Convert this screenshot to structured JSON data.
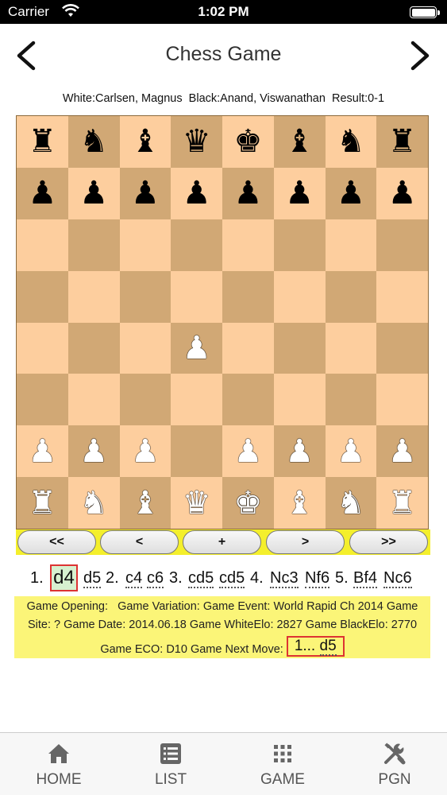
{
  "status_bar": {
    "carrier": "Carrier",
    "time": "1:02 PM"
  },
  "nav": {
    "title": "Chess Game",
    "back_icon": "chevron-left-icon",
    "forward_icon": "chevron-right-icon"
  },
  "players": "White:Carlsen, Magnus  Black:Anand, Viswanathan  Result:0-1",
  "board": {
    "light_color": "#fdce9e",
    "dark_color": "#d1a875",
    "rows": [
      [
        "br",
        "bn",
        "bb",
        "bq",
        "bk",
        "bb",
        "bn",
        "br"
      ],
      [
        "bp",
        "bp",
        "bp",
        "bp",
        "bp",
        "bp",
        "bp",
        "bp"
      ],
      [
        "",
        "",
        "",
        "",
        "",
        "",
        "",
        ""
      ],
      [
        "",
        "",
        "",
        "",
        "",
        "",
        "",
        ""
      ],
      [
        "",
        "",
        "",
        "wp",
        "",
        "",
        "",
        ""
      ],
      [
        "",
        "",
        "",
        "",
        "",
        "",
        "",
        ""
      ],
      [
        "wp",
        "wp",
        "wp",
        "",
        "wp",
        "wp",
        "wp",
        "wp"
      ],
      [
        "wr",
        "wn",
        "wb",
        "wq",
        "wk",
        "wb",
        "wn",
        "wr"
      ]
    ]
  },
  "controls": {
    "first": "<<",
    "prev": "<",
    "add": "+",
    "next": ">",
    "last": ">>"
  },
  "moves": {
    "n1": "1.",
    "m1w": "d4",
    "m1b": "d5",
    "n2": "2.",
    "m2w": "c4",
    "m2b": "c6",
    "n3": "3.",
    "m3w": "cd5",
    "m3b": "cd5",
    "n4": "4.",
    "m4w": "Nc3",
    "m4b": "Nf6",
    "n5": "5.",
    "m5w": "Bf4",
    "m5b": "Nc6"
  },
  "info": {
    "line1": "Game Opening:   Game Variation: Game Event: World Rapid Ch 2014 Game",
    "line2": "Site: ? Game Date: 2014.06.18 Game WhiteElo: 2827 Game BlackElo: 2770",
    "line3": "Game ECO: D10 Game Next Move:",
    "next_num": "1...",
    "next_move": "d5"
  },
  "tabs": [
    {
      "label": "HOME",
      "icon": "home-icon"
    },
    {
      "label": "LIST",
      "icon": "list-icon"
    },
    {
      "label": "GAME",
      "icon": "grid-icon"
    },
    {
      "label": "PGN",
      "icon": "tools-icon"
    }
  ]
}
